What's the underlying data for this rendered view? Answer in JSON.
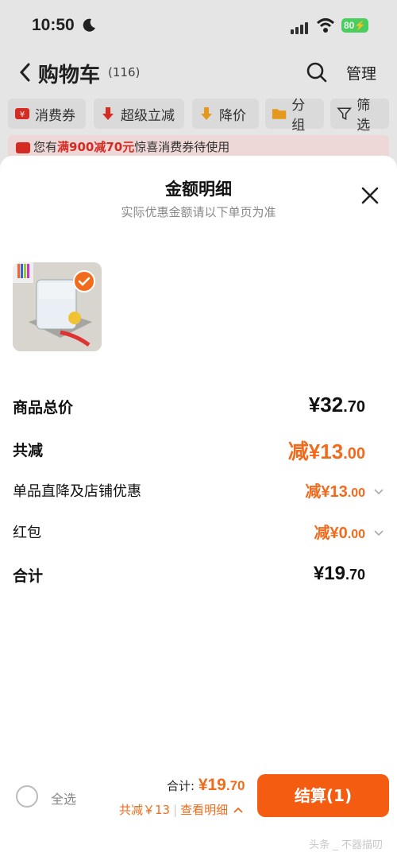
{
  "status_bar": {
    "time": "10:50",
    "battery": "80"
  },
  "header": {
    "back_label": "<",
    "title": "购物车",
    "count": "(116)",
    "manage": "管理"
  },
  "chips": [
    {
      "label": "消费券",
      "icon": "coupon-icon"
    },
    {
      "label": "超级立减",
      "icon": "down-arrow-icon"
    },
    {
      "label": "降价",
      "icon": "price-drop-icon"
    },
    {
      "label": "分组",
      "icon": "folder-icon"
    },
    {
      "label": "筛选",
      "icon": "filter-icon"
    }
  ],
  "notice": {
    "prefix": "您有",
    "highlight": "满900减70元",
    "suffix": "惊喜消费券待使用"
  },
  "sheet": {
    "title": "金额明细",
    "subtitle": "实际优惠金额请以下单页为准",
    "rows": [
      {
        "label": "商品总价",
        "value_main": "¥32",
        "value_dec": ".70"
      },
      {
        "label": "共减",
        "value_main": "减¥13",
        "value_dec": ".00"
      },
      {
        "label": "单品直降及店铺优惠",
        "value_main": "减¥13",
        "value_dec": ".00"
      },
      {
        "label": "红包",
        "value_main": "减¥0",
        "value_dec": ".00"
      },
      {
        "label": "合计",
        "value_main": "¥19",
        "value_dec": ".70"
      }
    ]
  },
  "bottom_bar": {
    "select_all": "全选",
    "total_prefix": "合计: ",
    "total_main": "¥19",
    "total_dec": ".70",
    "discount": "共减￥13",
    "detail": "查看明细",
    "checkout": "结算(1)"
  },
  "watermark": "头条 _ 不器描叨",
  "colors": {
    "accent": "#f26b1d",
    "checkout": "#f45d11",
    "notice_bg": "#fbe3e3"
  }
}
